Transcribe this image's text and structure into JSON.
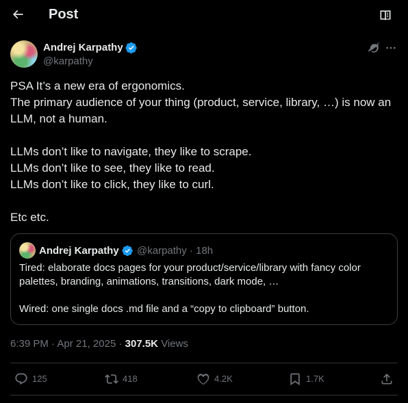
{
  "header": {
    "title": "Post"
  },
  "icons": {
    "back": "arrow-left-icon",
    "reader": "reader-mode-icon",
    "verified": "verified-badge-icon",
    "grok": "grok-icon",
    "more": "more-horizontal-icon",
    "reply": "reply-icon",
    "repost": "repost-icon",
    "like": "heart-icon",
    "bookmark": "bookmark-icon",
    "share": "share-icon"
  },
  "colors": {
    "background": "#000000",
    "text": "#e7e9ea",
    "secondary_text": "#71767b",
    "verified_blue": "#1d9bf0",
    "divider": "#2f3336"
  },
  "post": {
    "author": {
      "name": "Andrej Karpathy",
      "handle": "@karpathy"
    },
    "lines": [
      "PSA It’s a new era of ergonomics.",
      "The primary audience of your thing (product, service, library, …) is now an",
      "LLM, not a human.",
      "",
      "LLMs don’t like to navigate, they like to scrape.",
      "LLMs don’t like to see, they like to read.",
      "LLMs don’t like to click, they like to curl.",
      "",
      "Etc etc."
    ],
    "time": "6:39 PM",
    "date": "Apr 21, 2025",
    "views_count": "307.5K",
    "views_label": "Views"
  },
  "quote": {
    "author": {
      "name": "Andrej Karpathy",
      "handle": "@karpathy",
      "age": "18h"
    },
    "lines": [
      "Tired: elaborate docs pages for your product/service/library with fancy color",
      "palettes, branding, animations, transitions, dark mode, …",
      "",
      "Wired: one single docs .md file and a “copy to clipboard” button."
    ]
  },
  "actions": {
    "replies": "125",
    "reposts": "418",
    "likes": "4.2K",
    "bookmarks": "1.7K"
  }
}
